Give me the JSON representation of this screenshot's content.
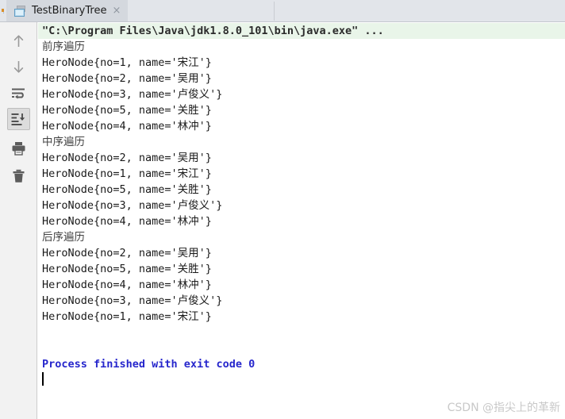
{
  "tabbar": {
    "tab_label": "TestBinaryTree",
    "close_label": "×",
    "icon": "console-window-icon",
    "stub_text": ":"
  },
  "toolbar": {
    "items": [
      {
        "name": "up-arrow-icon",
        "title": "Up",
        "active": false
      },
      {
        "name": "down-arrow-icon",
        "title": "Down",
        "active": false
      },
      {
        "name": "soft-wrap-icon",
        "title": "Soft-Wrap",
        "active": false
      },
      {
        "name": "scroll-to-end-icon",
        "title": "Scroll to End",
        "active": true
      },
      {
        "name": "print-icon",
        "title": "Print",
        "active": false
      },
      {
        "name": "trash-icon",
        "title": "Clear All",
        "active": false
      }
    ]
  },
  "console": {
    "lines": [
      {
        "type": "cmd",
        "text": "\"C:\\Program Files\\Java\\jdk1.8.0_101\\bin\\java.exe\" ..."
      },
      {
        "type": "label",
        "text": "前序遍历"
      },
      {
        "type": "node",
        "text": "HeroNode{no=1, name='宋江'}"
      },
      {
        "type": "node",
        "text": "HeroNode{no=2, name='吴用'}"
      },
      {
        "type": "node",
        "text": "HeroNode{no=3, name='卢俊义'}"
      },
      {
        "type": "node",
        "text": "HeroNode{no=5, name='关胜'}"
      },
      {
        "type": "node",
        "text": "HeroNode{no=4, name='林冲'}"
      },
      {
        "type": "label",
        "text": "中序遍历"
      },
      {
        "type": "node",
        "text": "HeroNode{no=2, name='吴用'}"
      },
      {
        "type": "node",
        "text": "HeroNode{no=1, name='宋江'}"
      },
      {
        "type": "node",
        "text": "HeroNode{no=5, name='关胜'}"
      },
      {
        "type": "node",
        "text": "HeroNode{no=3, name='卢俊义'}"
      },
      {
        "type": "node",
        "text": "HeroNode{no=4, name='林冲'}"
      },
      {
        "type": "label",
        "text": "后序遍历"
      },
      {
        "type": "node",
        "text": "HeroNode{no=2, name='吴用'}"
      },
      {
        "type": "node",
        "text": "HeroNode{no=5, name='关胜'}"
      },
      {
        "type": "node",
        "text": "HeroNode{no=4, name='林冲'}"
      },
      {
        "type": "node",
        "text": "HeroNode{no=3, name='卢俊义'}"
      },
      {
        "type": "node",
        "text": "HeroNode{no=1, name='宋江'}"
      },
      {
        "type": "blank",
        "text": " "
      },
      {
        "type": "blank",
        "text": " "
      },
      {
        "type": "exit",
        "text": "Process finished with exit code 0"
      }
    ]
  },
  "watermark": {
    "text": "CSDN @指尖上的革新"
  },
  "colors": {
    "tabbar_bg": "#e2e5ea",
    "tab_selected_bg": "#d4d8de",
    "toolbar_bg": "#f2f2f2",
    "console_bg": "#ffffff",
    "cmd_line_bg": "#e9f5e9",
    "exit_text": "#2626cc",
    "watermark": "#c8c8c8"
  }
}
